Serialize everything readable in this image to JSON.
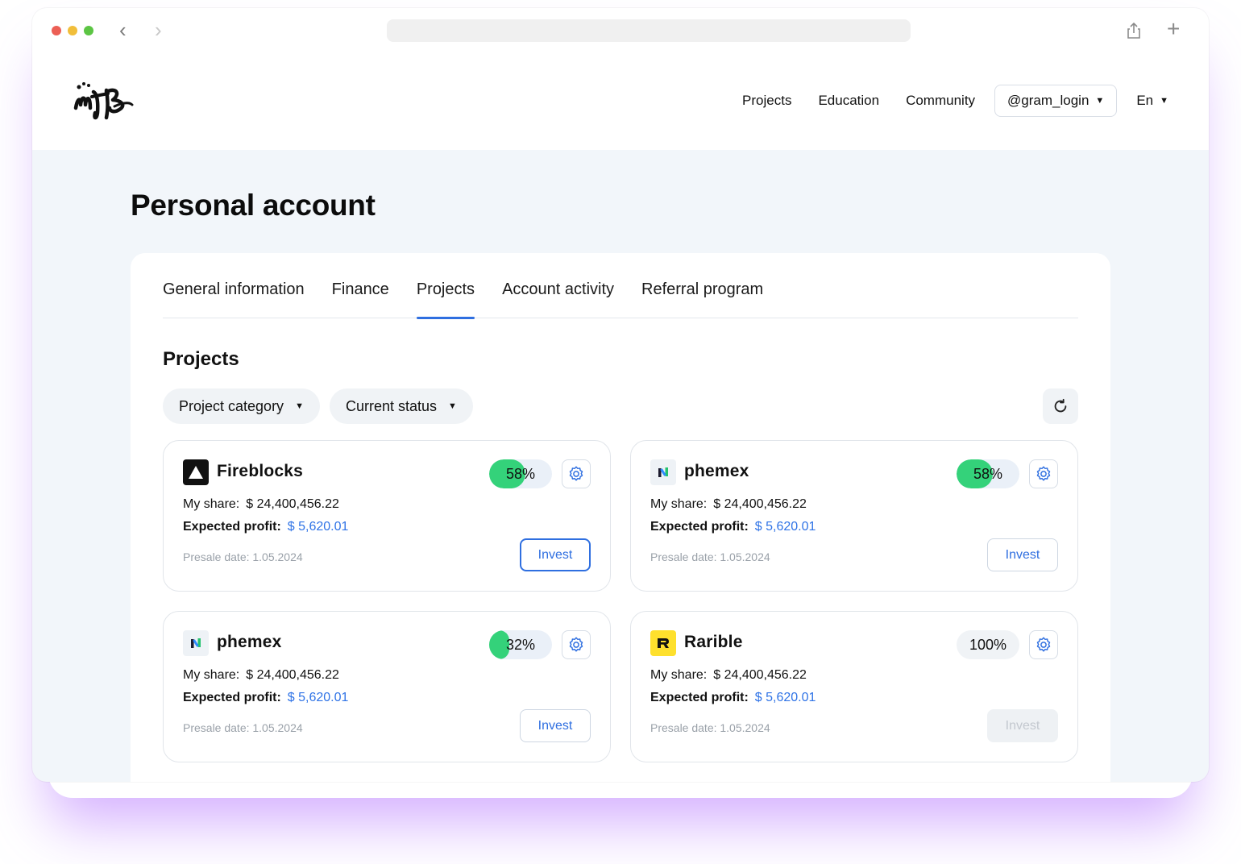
{
  "nav": {
    "projects": "Projects",
    "education": "Education",
    "community": "Community",
    "login": "@gram_login",
    "lang": "En"
  },
  "page": {
    "title": "Personal account"
  },
  "tabs": [
    "General information",
    "Finance",
    "Projects",
    "Account activity",
    "Referral program"
  ],
  "section": {
    "title": "Projects"
  },
  "filters": {
    "category": "Project category",
    "status": "Current status"
  },
  "cards": [
    {
      "name": "Fireblocks",
      "progress": 58,
      "progress_label": "58%",
      "share_label": "My share:",
      "share": "$ 24,400,456.22",
      "profit_label": "Expected profit:",
      "profit": "$ 5,620.01",
      "presale": "Presale date: 1.05.2024",
      "invest": "Invest"
    },
    {
      "name": "phemex",
      "progress": 58,
      "progress_label": "58%",
      "share_label": "My share:",
      "share": "$ 24,400,456.22",
      "profit_label": "Expected profit:",
      "profit": "$ 5,620.01",
      "presale": "Presale date: 1.05.2024",
      "invest": "Invest"
    },
    {
      "name": "phemex",
      "progress": 32,
      "progress_label": "32%",
      "share_label": "My share:",
      "share": "$ 24,400,456.22",
      "profit_label": "Expected profit:",
      "profit": "$ 5,620.01",
      "presale": "Presale date: 1.05.2024",
      "invest": "Invest"
    },
    {
      "name": "Rarible",
      "progress": 100,
      "progress_label": "100%",
      "share_label": "My share:",
      "share": "$ 24,400,456.22",
      "profit_label": "Expected profit:",
      "profit": "$ 5,620.01",
      "presale": "Presale date: 1.05.2024",
      "invest": "Invest"
    }
  ],
  "colors": {
    "accent": "#2f6fe0",
    "progress": "#34d27a",
    "profit": "#2f73e6",
    "background": "#f2f6fa"
  }
}
